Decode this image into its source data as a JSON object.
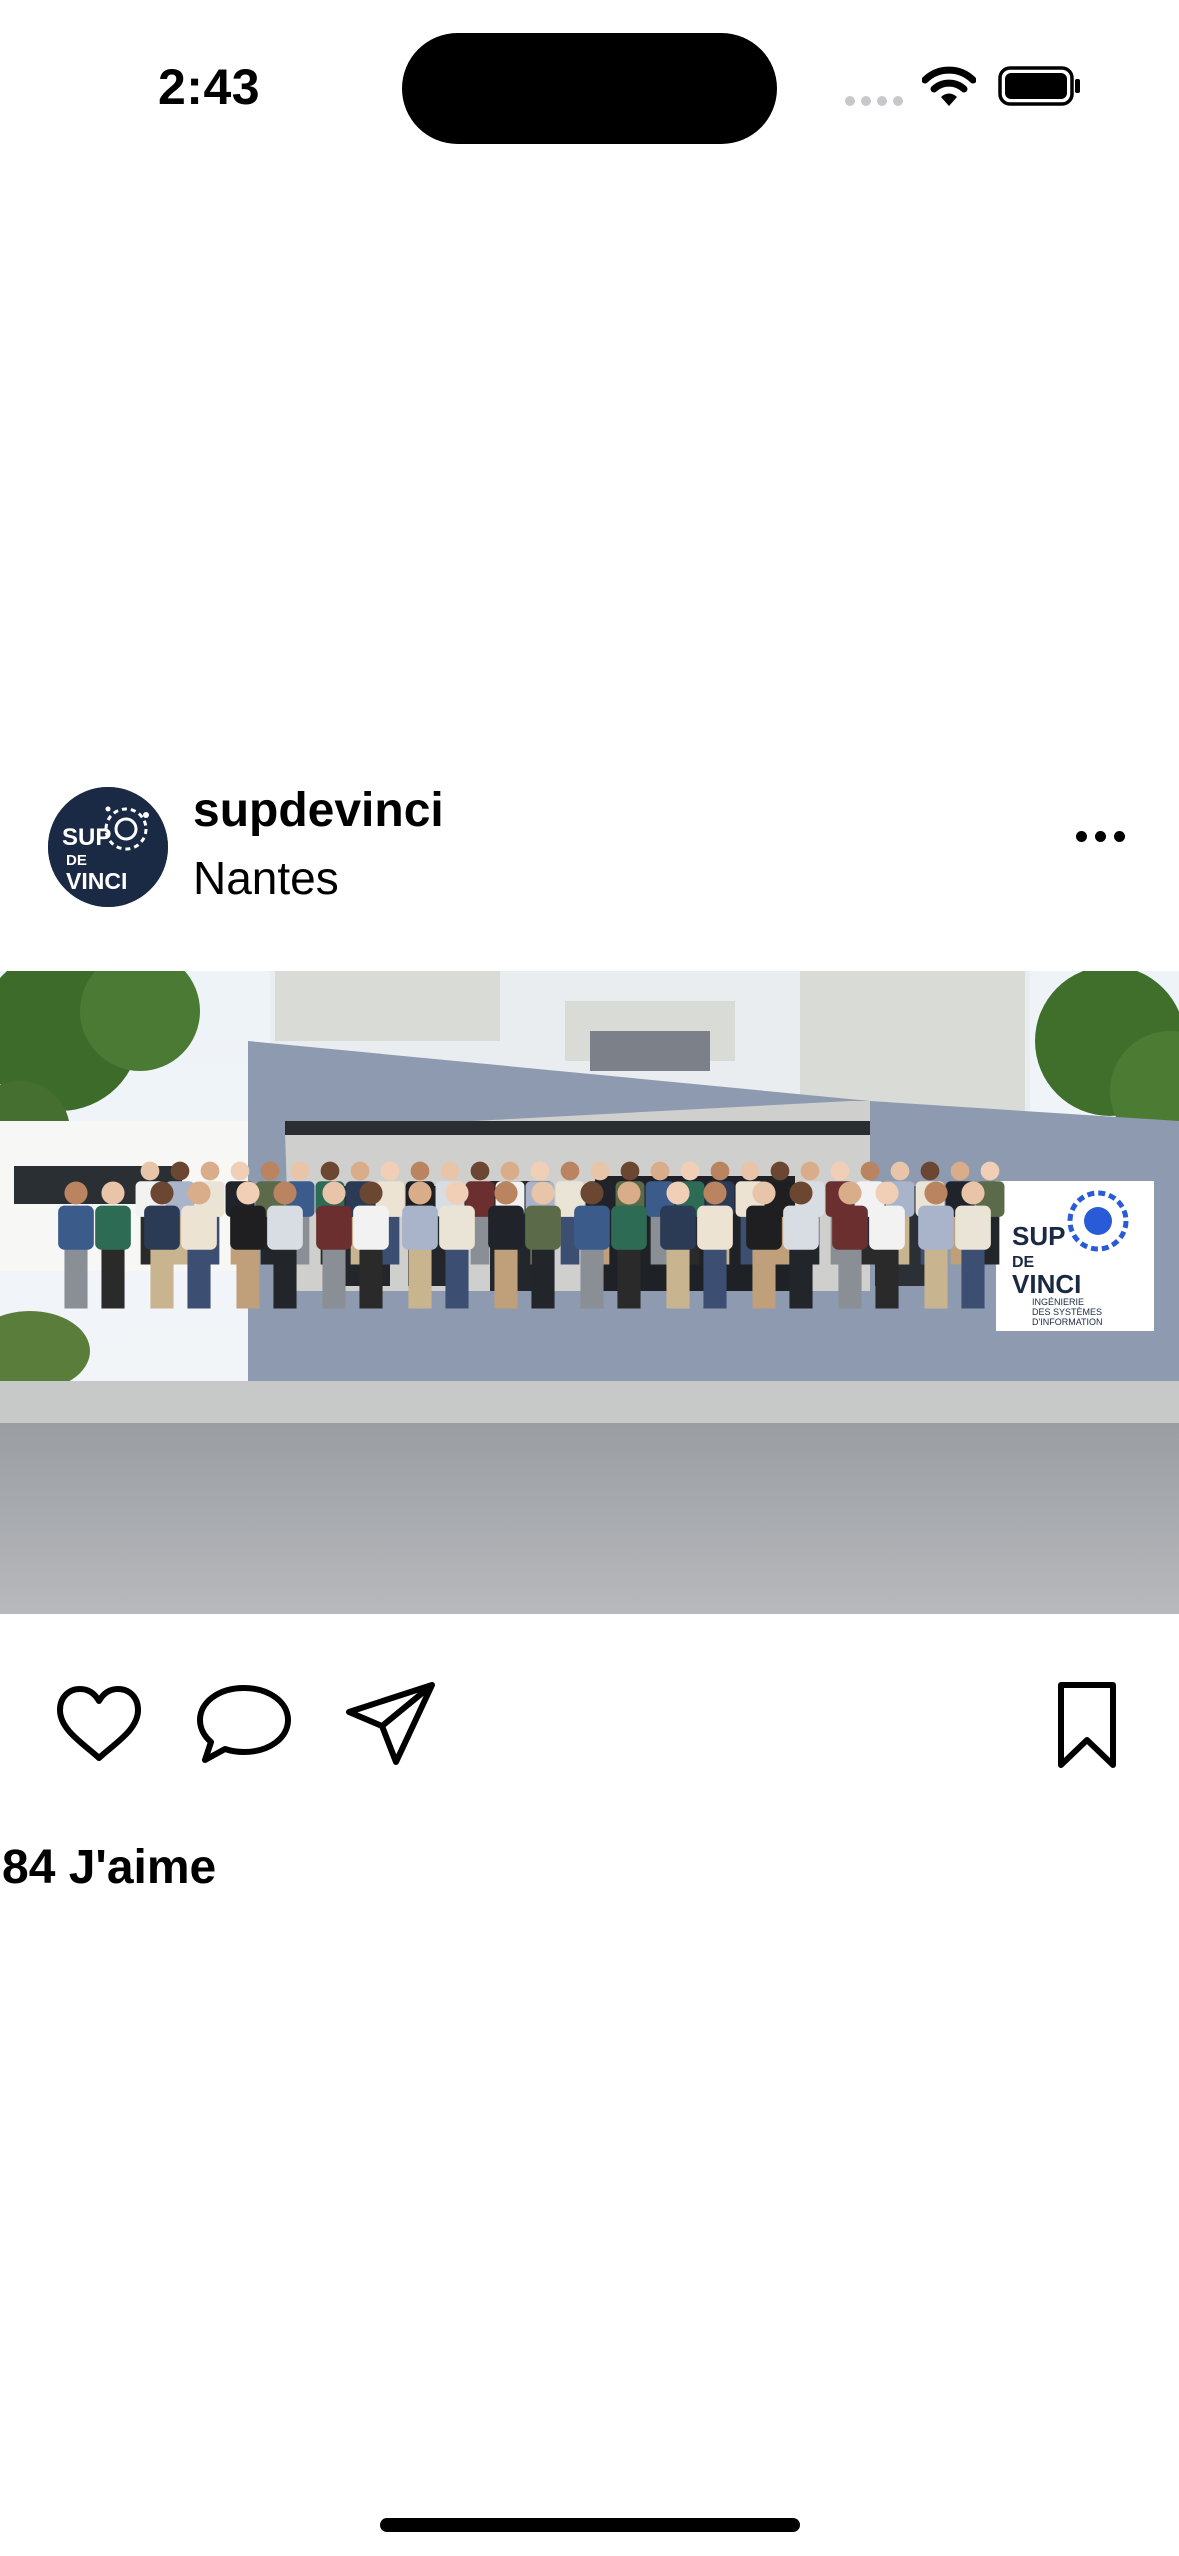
{
  "status_bar": {
    "time": "2:43",
    "icons": [
      "cellular-signal-icon",
      "wifi-icon",
      "battery-icon"
    ]
  },
  "post": {
    "username": "supdevinci",
    "location": "Nantes",
    "avatar": {
      "logo_lines": [
        "SUP",
        "DE",
        "VINCI"
      ],
      "background_color": "#1b2a44"
    },
    "photo": {
      "sign_lines": [
        "SUP",
        "DE",
        "VINCI",
        "INGÉNIERIE",
        "DES SYSTÈMES",
        "D'INFORMATION"
      ]
    },
    "likes_label": "84 J'aime",
    "actions": [
      "heart-icon",
      "comment-icon",
      "paper-plane-icon",
      "bookmark-icon"
    ]
  },
  "colors": {
    "background": "#ffffff",
    "text": "#000000",
    "brand_navy": "#1b2a44",
    "brand_blue": "#2a5bd7"
  }
}
